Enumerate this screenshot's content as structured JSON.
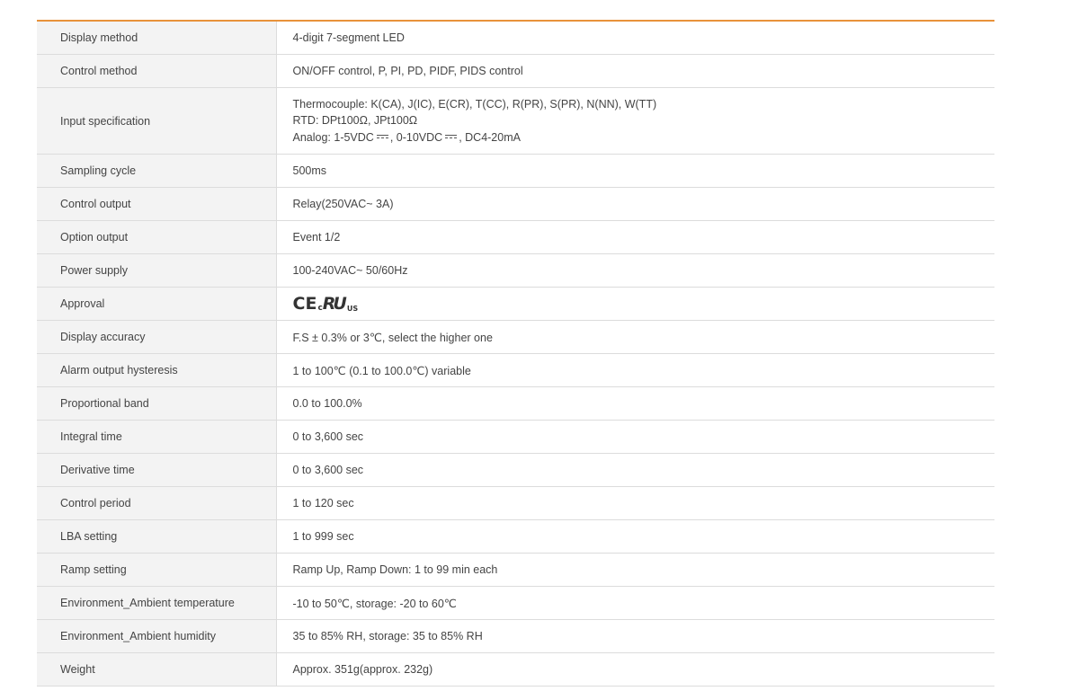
{
  "specs": {
    "rows": [
      {
        "label": "Display method",
        "value": "4-digit 7-segment LED"
      },
      {
        "label": "Control method",
        "value": "ON/OFF control, P, PI, PD, PIDF, PIDS control"
      },
      {
        "label": "Input specification",
        "lines": [
          {
            "text": "Thermocouple: K(CA), J(IC), E(CR), T(CC), R(PR), S(PR), N(NN), W(TT)"
          },
          {
            "text": "RTD: DPt100Ω, JPt100Ω"
          },
          {
            "a": "Analog: 1-5VDC",
            "b": ", 0-10VDC",
            "c": ", DC4-20mA"
          }
        ]
      },
      {
        "label": "Sampling cycle",
        "value": "500ms"
      },
      {
        "label": "Control output",
        "value": "Relay(250VAC~ 3A)"
      },
      {
        "label": "Option output",
        "value": "Event 1/2"
      },
      {
        "label": "Power supply",
        "value": "100-240VAC~ 50/60Hz"
      },
      {
        "label": "Approval",
        "marks": {
          "ce": "CE",
          "c": "c",
          "ul": "RU",
          "us": "US"
        }
      },
      {
        "label": "Display accuracy",
        "value": "F.S ± 0.3% or 3℃, select the higher one"
      },
      {
        "label": "Alarm output hysteresis",
        "value": "1 to 100℃ (0.1 to 100.0℃) variable"
      },
      {
        "label": "Proportional band",
        "value": "0.0 to 100.0%"
      },
      {
        "label": "Integral time",
        "value": "0 to 3,600 sec"
      },
      {
        "label": "Derivative time",
        "value": "0 to 3,600 sec"
      },
      {
        "label": "Control period",
        "value": "1 to 120 sec"
      },
      {
        "label": "LBA setting",
        "value": "1 to 999 sec"
      },
      {
        "label": "Ramp setting",
        "value": "Ramp Up, Ramp Down: 1 to 99 min each"
      },
      {
        "label": "Environment_Ambient temperature",
        "value": "-10 to 50℃, storage: -20 to 60℃"
      },
      {
        "label": "Environment_Ambient humidity",
        "value": "35 to 85% RH, storage: 35 to 85% RH"
      },
      {
        "label": "Weight",
        "value": "Approx. 351g(approx. 232g)"
      }
    ]
  },
  "colors": {
    "accent_rule": "#e8923a",
    "label_bg": "#f3f3f3",
    "border": "#dcdcdc",
    "text": "#444444"
  },
  "icons": {
    "dc": "dc-symbol-icon",
    "approval": [
      "ce-mark-icon",
      "cul-us-mark-icon"
    ]
  }
}
